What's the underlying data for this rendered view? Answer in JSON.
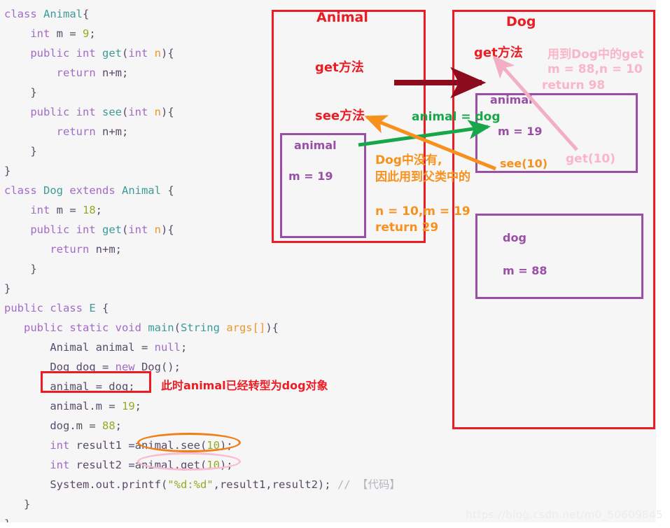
{
  "code": {
    "language": "java",
    "lines": [
      [
        {
          "t": "class ",
          "c": "kw"
        },
        {
          "t": "Animal",
          "c": "type"
        },
        {
          "t": "{",
          "c": "plain"
        }
      ],
      [
        {
          "t": "    int ",
          "c": "kw"
        },
        {
          "t": "m = ",
          "c": "plain"
        },
        {
          "t": "9",
          "c": "num"
        },
        {
          "t": ";",
          "c": "plain"
        }
      ],
      [
        {
          "t": "    public int ",
          "c": "kw"
        },
        {
          "t": "get",
          "c": "type"
        },
        {
          "t": "(",
          "c": "plain"
        },
        {
          "t": "int ",
          "c": "kw"
        },
        {
          "t": "n",
          "c": "param"
        },
        {
          "t": "){",
          "c": "plain"
        }
      ],
      [
        {
          "t": "        return ",
          "c": "kw"
        },
        {
          "t": "n+m;",
          "c": "plain"
        }
      ],
      [
        {
          "t": "    }",
          "c": "plain"
        }
      ],
      [
        {
          "t": "    public int ",
          "c": "kw"
        },
        {
          "t": "see",
          "c": "type"
        },
        {
          "t": "(",
          "c": "plain"
        },
        {
          "t": "int ",
          "c": "kw"
        },
        {
          "t": "n",
          "c": "param"
        },
        {
          "t": "){",
          "c": "plain"
        }
      ],
      [
        {
          "t": "        return ",
          "c": "kw"
        },
        {
          "t": "n+m;",
          "c": "plain"
        }
      ],
      [
        {
          "t": "    }",
          "c": "plain"
        }
      ],
      [
        {
          "t": "}",
          "c": "plain"
        }
      ],
      [
        {
          "t": "class ",
          "c": "kw"
        },
        {
          "t": "Dog ",
          "c": "type"
        },
        {
          "t": "extends ",
          "c": "kw"
        },
        {
          "t": "Animal ",
          "c": "type"
        },
        {
          "t": "{",
          "c": "plain"
        }
      ],
      [
        {
          "t": "    int ",
          "c": "kw"
        },
        {
          "t": "m = ",
          "c": "plain"
        },
        {
          "t": "18",
          "c": "num"
        },
        {
          "t": ";",
          "c": "plain"
        }
      ],
      [
        {
          "t": "    public int ",
          "c": "kw"
        },
        {
          "t": "get",
          "c": "type"
        },
        {
          "t": "(",
          "c": "plain"
        },
        {
          "t": "int ",
          "c": "kw"
        },
        {
          "t": "n",
          "c": "param"
        },
        {
          "t": "){",
          "c": "plain"
        }
      ],
      [
        {
          "t": "       return ",
          "c": "kw"
        },
        {
          "t": "n+m;",
          "c": "plain"
        }
      ],
      [
        {
          "t": "    }",
          "c": "plain"
        }
      ],
      [
        {
          "t": "}",
          "c": "plain"
        }
      ],
      [
        {
          "t": "public class ",
          "c": "kw"
        },
        {
          "t": "E ",
          "c": "type"
        },
        {
          "t": "{",
          "c": "plain"
        }
      ],
      [
        {
          "t": "   public static void ",
          "c": "kw"
        },
        {
          "t": "main",
          "c": "type"
        },
        {
          "t": "(",
          "c": "plain"
        },
        {
          "t": "String ",
          "c": "type"
        },
        {
          "t": "args[]",
          "c": "param"
        },
        {
          "t": "){",
          "c": "plain"
        }
      ],
      [
        {
          "t": "       Animal animal = ",
          "c": "plain"
        },
        {
          "t": "null",
          "c": "kw"
        },
        {
          "t": ";",
          "c": "plain"
        }
      ],
      [
        {
          "t": "       Dog dog = ",
          "c": "plain"
        },
        {
          "t": "new ",
          "c": "kw"
        },
        {
          "t": "Dog();",
          "c": "plain"
        }
      ],
      [
        {
          "t": "       animal = dog;",
          "c": "plain"
        }
      ],
      [
        {
          "t": "       animal.m = ",
          "c": "plain"
        },
        {
          "t": "19",
          "c": "num"
        },
        {
          "t": ";",
          "c": "plain"
        }
      ],
      [
        {
          "t": "       dog.m = ",
          "c": "plain"
        },
        {
          "t": "88",
          "c": "num"
        },
        {
          "t": ";",
          "c": "plain"
        }
      ],
      [
        {
          "t": "       int ",
          "c": "kw"
        },
        {
          "t": "result1 =animal.see(",
          "c": "plain"
        },
        {
          "t": "10",
          "c": "num"
        },
        {
          "t": ");",
          "c": "plain"
        }
      ],
      [
        {
          "t": "       int ",
          "c": "kw"
        },
        {
          "t": "result2 =animal.get(",
          "c": "plain"
        },
        {
          "t": "10",
          "c": "num"
        },
        {
          "t": ");",
          "c": "plain"
        }
      ],
      [
        {
          "t": "       System.out.printf(",
          "c": "plain"
        },
        {
          "t": "\"%d:%d\"",
          "c": "str"
        },
        {
          "t": ",result1,result2); ",
          "c": "plain"
        },
        {
          "t": "// 【代码】",
          "c": "cmt"
        }
      ],
      [
        {
          "t": "   }",
          "c": "plain"
        }
      ],
      [
        {
          "t": "}",
          "c": "plain"
        }
      ]
    ],
    "annotation": {
      "highlighted_line": "animal = dog;",
      "note": "此时animal已经转型为dog对象",
      "ellipse_see": "animal.see(10);",
      "ellipse_get": "animal.get(10);"
    }
  },
  "diagram": {
    "animal_region": {
      "title": "Animal",
      "get_method": "get方法",
      "see_method": "see方法",
      "object_box": {
        "name": "animal",
        "field": "m = 19"
      }
    },
    "dog_region": {
      "title": "Dog",
      "get_method": "get方法",
      "object_box": {
        "name": "animal",
        "field": "m = 19",
        "call": "see(10)"
      },
      "dog_box": {
        "name": "dog",
        "field": "m = 88"
      },
      "pink_note": [
        "用到Dog中的get",
        "m = 88,n = 10",
        "return 98"
      ],
      "pink_call": "get(10)"
    },
    "green_label": "animal = dog",
    "orange_note": [
      "Dog中没有,",
      "因此用到父类中的"
    ],
    "orange_result": [
      "n = 10,m = 19",
      "return 29"
    ],
    "colors": {
      "red": "#ec1c24",
      "purple": "#9b4ea8",
      "orange": "#f7911e",
      "green": "#17a74a",
      "pink": "#f9b6c8",
      "dark_red": "#8c0b1c"
    }
  },
  "watermark": "https://blog.csdn.net/m0_50609845"
}
